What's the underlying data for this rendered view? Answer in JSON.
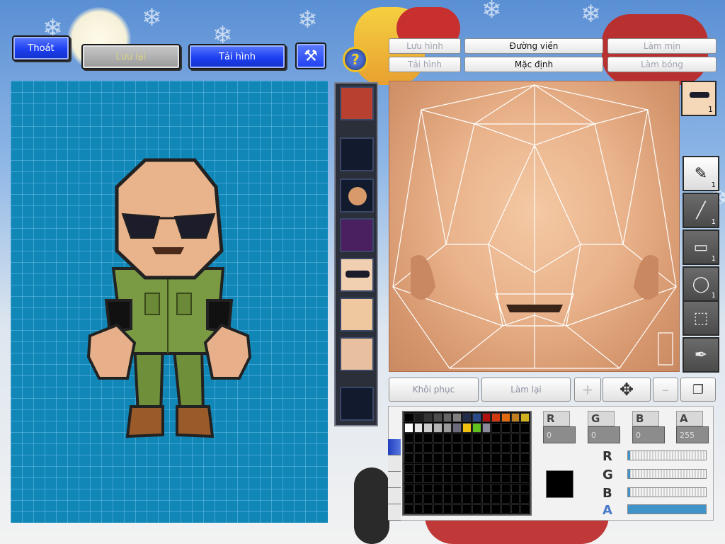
{
  "toolbar": {
    "exit_label": "Thoát",
    "save_label": "Lưu lại",
    "reload_image_label": "Tải hình"
  },
  "face_editor": {
    "save_image_label": "Lưu hình",
    "load_image_label": "Tải hình",
    "outline_label": "Đường viền",
    "default_label": "Mặc định",
    "smooth_label": "Làm mịn",
    "shade_label": "Làm bóng"
  },
  "tools": [
    {
      "name": "brush",
      "icon": "brush-icon",
      "count": "1"
    },
    {
      "name": "line",
      "icon": "line-icon",
      "count": "1"
    },
    {
      "name": "rectangle",
      "icon": "rectangle-icon",
      "count": "1"
    },
    {
      "name": "ellipse",
      "icon": "ellipse-icon",
      "count": "1"
    },
    {
      "name": "select",
      "icon": "marquee-icon",
      "count": ""
    },
    {
      "name": "eyedropper",
      "icon": "eyedropper-icon",
      "count": ""
    }
  ],
  "avatar_badge_count": "1",
  "actions": {
    "restore_label": "Khôi phục",
    "redo_label": "Làm lại"
  },
  "color": {
    "r_label": "R",
    "g_label": "G",
    "b_label": "B",
    "a_label": "A",
    "r": "0",
    "g": "0",
    "b": "0",
    "a": "255",
    "current": "#000000",
    "r_fraction": 0,
    "g_fraction": 0,
    "b_fraction": 0,
    "a_fraction": 1
  },
  "palette_colors": [
    "#000000",
    "#1a1a1a",
    "#333333",
    "#4d4d4d",
    "#666666",
    "#808080",
    "#202c4a",
    "#2a4a8a",
    "#b01010",
    "#d03a10",
    "#e06a10",
    "#c08020",
    "#d0b020",
    "#ffffff",
    "#e6e6e6",
    "#cccccc",
    "#b3b3b3",
    "#999999",
    "#6a6a7a",
    "#f0c010",
    "#60c020",
    "#8a8a9a"
  ],
  "part_slots": [
    "hair",
    "empty",
    "head",
    "body",
    "sunglasses",
    "face",
    "beard",
    "empty"
  ]
}
